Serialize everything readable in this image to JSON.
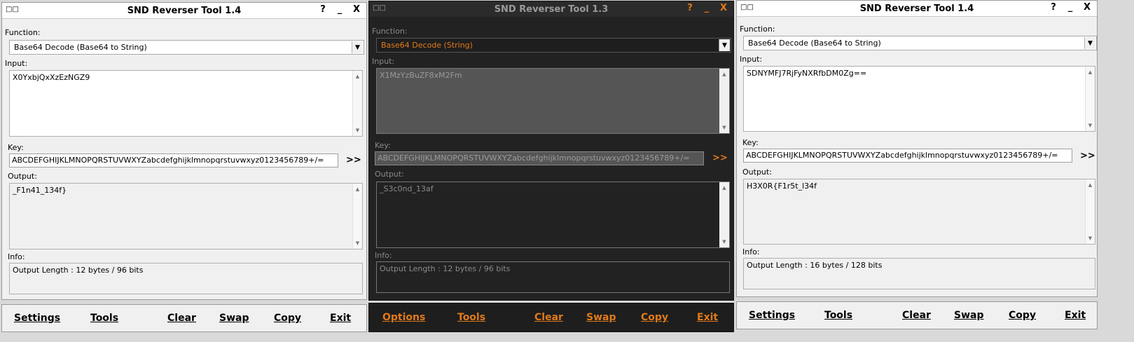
{
  "windows": [
    {
      "title": "SND Reverser Tool 1.4",
      "controls": [
        "?",
        "_",
        "X"
      ],
      "function_label": "Function:",
      "function_value": "Base64 Decode (Base64 to String)",
      "input_label": "Input:",
      "input_value": "X0YxbjQxXzEzNGZ9",
      "key_label": "Key:",
      "key_value": "ABCDEFGHIJKLMNOPQRSTUVWXYZabcdefghijklmnopqrstuvwxyz0123456789+/=",
      "go_label": ">>",
      "output_label": "Output:",
      "output_value": "_F1n41_134f}",
      "info_label": "Info:",
      "info_value": "Output Length : 12 bytes / 96 bits",
      "buttons": [
        "Settings",
        "Tools",
        "Clear",
        "Swap",
        "Copy",
        "Exit"
      ]
    },
    {
      "title": "SND Reverser Tool 1.3",
      "controls": [
        "?",
        "_",
        "X"
      ],
      "function_label": "Function:",
      "function_value": "Base64 Decode (String)",
      "input_label": "Input:",
      "input_value": "X1MzYzBuZF8xM2Fm",
      "key_label": "Key:",
      "key_value": "ABCDEFGHIJKLMNOPQRSTUVWXYZabcdefghijklmnopqrstuvwxyz0123456789+/=",
      "go_label": ">>",
      "output_label": "Output:",
      "output_value": "_S3c0nd_13af",
      "info_label": "Info:",
      "info_value": "Output Length : 12 bytes / 96 bits",
      "buttons": [
        "Options",
        "Tools",
        "Clear",
        "Swap",
        "Copy",
        "Exit"
      ]
    },
    {
      "title": "SND Reverser Tool 1.4",
      "controls": [
        "?",
        "_",
        "X"
      ],
      "function_label": "Function:",
      "function_value": "Base64 Decode (Base64 to String)",
      "input_label": "Input:",
      "input_value": "SDNYMFJ7RjFyNXRfbDM0Zg==",
      "key_label": "Key:",
      "key_value": "ABCDEFGHIJKLMNOPQRSTUVWXYZabcdefghijklmnopqrstuvwxyz0123456789+/=",
      "go_label": ">>",
      "output_label": "Output:",
      "output_value": "H3X0R{F1r5t_l34f",
      "info_label": "Info:",
      "info_value": "Output Length : 16 bytes / 128 bits",
      "buttons": [
        "Settings",
        "Tools",
        "Clear",
        "Swap",
        "Copy",
        "Exit"
      ]
    }
  ],
  "icons": {
    "window_icon": "app-window-icon",
    "dropdown": "chevron-down-icon",
    "scroll_up": "scroll-up-icon",
    "scroll_down": "scroll-down-icon"
  },
  "colors": {
    "dark_accent": "#e07a1a",
    "light_bg": "#f0f0f0",
    "dark_bg": "#222222"
  }
}
